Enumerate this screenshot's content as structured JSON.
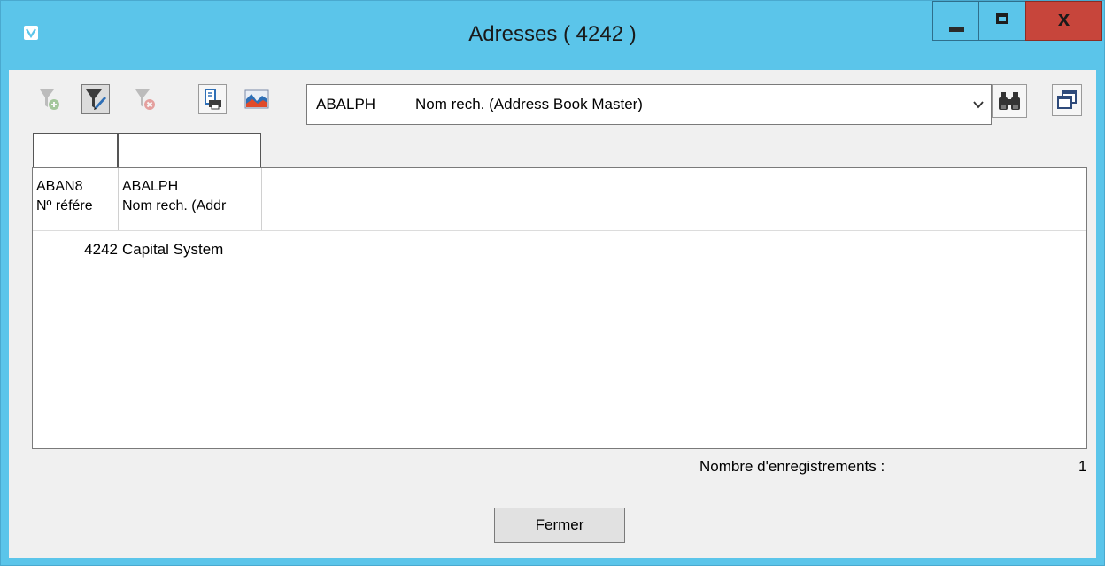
{
  "window": {
    "title": "Adresses ( 4242 )",
    "close_glyph": "x"
  },
  "toolbar": {
    "buttons": [
      {
        "name": "add-filter",
        "icon": "filter-add-icon",
        "enabled": false
      },
      {
        "name": "edit-filter",
        "icon": "filter-edit-icon",
        "enabled": true
      },
      {
        "name": "remove-filter",
        "icon": "filter-remove-icon",
        "enabled": false
      },
      {
        "name": "print",
        "icon": "print-icon",
        "enabled": true
      },
      {
        "name": "chart",
        "icon": "chart-icon",
        "enabled": true
      },
      {
        "name": "search",
        "icon": "binoculars-icon",
        "enabled": true
      },
      {
        "name": "restore",
        "icon": "windows-icon",
        "enabled": true
      }
    ]
  },
  "search_field": {
    "code": "ABALPH",
    "description": "Nom rech. (Address Book Master)"
  },
  "grid": {
    "columns": [
      {
        "field": "ABAN8",
        "label": "Nº référe"
      },
      {
        "field": "ABALPH",
        "label": "Nom rech. (Addr"
      }
    ],
    "rows": [
      {
        "number": "4242",
        "name": "Capital System"
      }
    ]
  },
  "footer": {
    "count_label": "Nombre d'enregistrements :",
    "count_value": "1",
    "close_label": "Fermer"
  },
  "colors": {
    "titlebar": "#5bc5ea",
    "close_button": "#c7453b",
    "client_background": "#f0f0f0"
  }
}
